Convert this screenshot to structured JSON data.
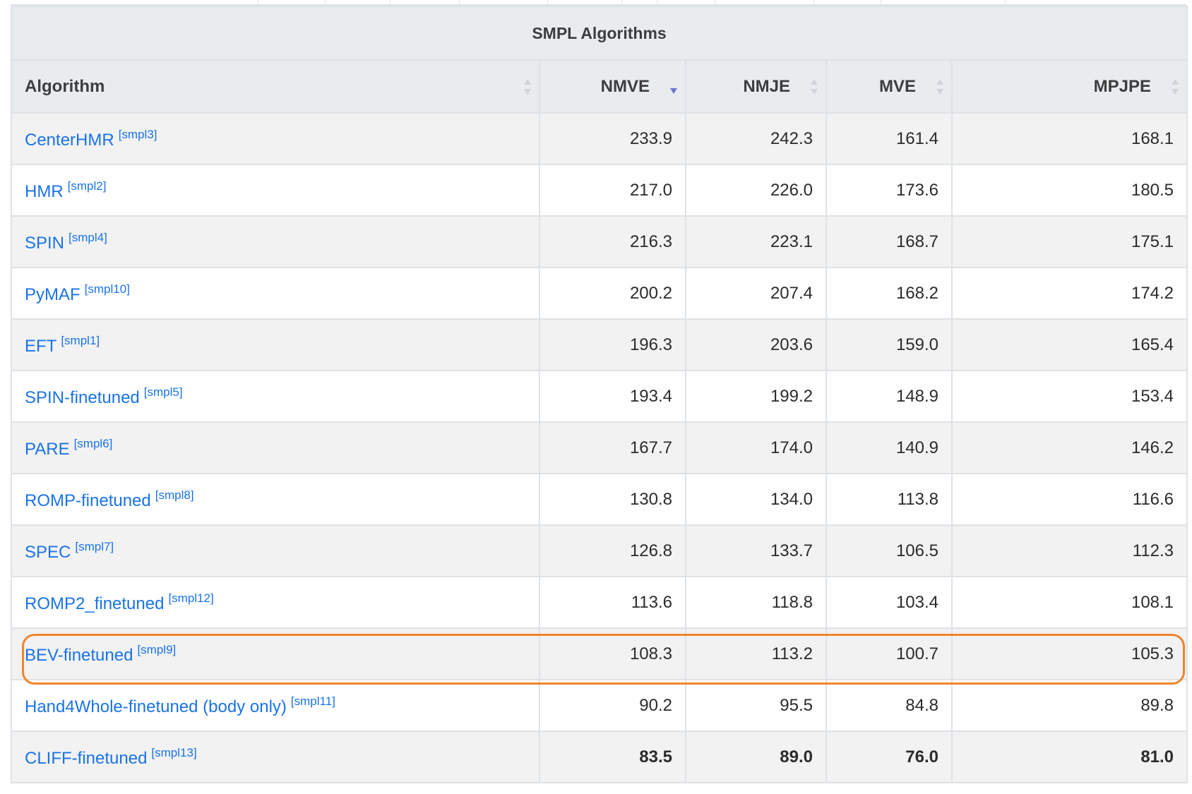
{
  "table": {
    "caption": "SMPL Algorithms",
    "columns": [
      {
        "label": "Algorithm",
        "sort": "none"
      },
      {
        "label": "NMVE",
        "sort": "desc"
      },
      {
        "label": "NMJE",
        "sort": "none"
      },
      {
        "label": "MVE",
        "sort": "none"
      },
      {
        "label": "MPJPE",
        "sort": "none"
      }
    ],
    "rows": [
      {
        "name": "CenterHMR",
        "ref": "[smpl3]",
        "values": [
          "233.9",
          "242.3",
          "161.4",
          "168.1"
        ]
      },
      {
        "name": "HMR",
        "ref": "[smpl2]",
        "values": [
          "217.0",
          "226.0",
          "173.6",
          "180.5"
        ]
      },
      {
        "name": "SPIN",
        "ref": "[smpl4]",
        "values": [
          "216.3",
          "223.1",
          "168.7",
          "175.1"
        ]
      },
      {
        "name": "PyMAF",
        "ref": "[smpl10]",
        "values": [
          "200.2",
          "207.4",
          "168.2",
          "174.2"
        ]
      },
      {
        "name": "EFT",
        "ref": "[smpl1]",
        "values": [
          "196.3",
          "203.6",
          "159.0",
          "165.4"
        ]
      },
      {
        "name": "SPIN-finetuned",
        "ref": "[smpl5]",
        "values": [
          "193.4",
          "199.2",
          "148.9",
          "153.4"
        ]
      },
      {
        "name": "PARE",
        "ref": "[smpl6]",
        "values": [
          "167.7",
          "174.0",
          "140.9",
          "146.2"
        ]
      },
      {
        "name": "ROMP-finetuned",
        "ref": "[smpl8]",
        "values": [
          "130.8",
          "134.0",
          "113.8",
          "116.6"
        ]
      },
      {
        "name": "SPEC",
        "ref": "[smpl7]",
        "values": [
          "126.8",
          "133.7",
          "106.5",
          "112.3"
        ]
      },
      {
        "name": "ROMP2_finetuned",
        "ref": "[smpl12]",
        "values": [
          "113.6",
          "118.8",
          "103.4",
          "108.1"
        ]
      },
      {
        "name": "BEV-finetuned",
        "ref": "[smpl9]",
        "values": [
          "108.3",
          "113.2",
          "100.7",
          "105.3"
        ]
      },
      {
        "name": "Hand4Whole-finetuned (body only)",
        "ref": "[smpl11]",
        "values": [
          "90.2",
          "95.5",
          "84.8",
          "89.8"
        ]
      },
      {
        "name": "CLIFF-finetuned",
        "ref": "[smpl13]",
        "values": [
          "83.5",
          "89.0",
          "76.0",
          "81.0"
        ]
      }
    ],
    "highlighted_row": "Hand4Whole-finetuned (body only)",
    "best_row": "CLIFF-finetuned"
  },
  "colors": {
    "link": "#1a73e8",
    "header_bg": "#e9ecef",
    "highlight": "#f0842c",
    "sort_active": "#6a75c9"
  }
}
